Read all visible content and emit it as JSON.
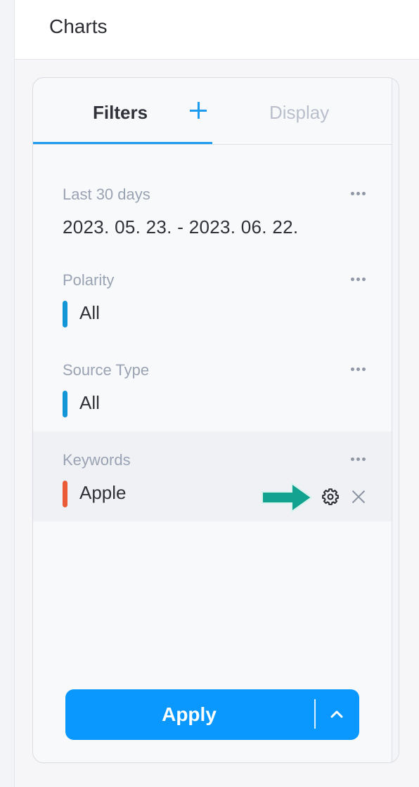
{
  "topbar": {
    "title": "Charts"
  },
  "tabs": {
    "filters": "Filters",
    "display": "Display"
  },
  "filters": [
    {
      "label": "Last 30 days",
      "value": "2023. 05. 23. - 2023. 06. 22.",
      "bar_color": null
    },
    {
      "label": "Polarity",
      "value": "All",
      "bar_color": "#1296d8"
    },
    {
      "label": "Source Type",
      "value": "All",
      "bar_color": "#1296d8"
    },
    {
      "label": "Keywords",
      "value": "Apple",
      "bar_color": "#ea5a36"
    }
  ],
  "icons": {
    "add": "plus-icon",
    "more": "more-dots-icon",
    "settings": "gear-icon",
    "remove": "close-icon",
    "pointer": "arrow-icon",
    "menu": "chevron-up-icon"
  },
  "apply": {
    "label": "Apply"
  },
  "colors": {
    "accent": "#0a98ff",
    "active_tab": "#1d9bf0",
    "arrow": "#12a28f"
  }
}
